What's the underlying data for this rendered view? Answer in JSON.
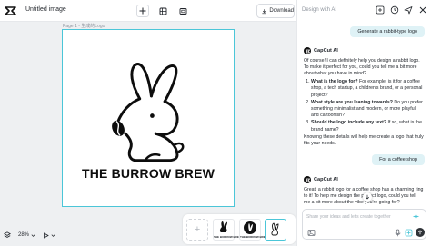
{
  "app": {
    "document_title": "Untitled image",
    "download_label": "Download"
  },
  "canvas": {
    "page_label": "Page 1 - 生成的Logo",
    "brand_text": "THE BURROW BREW",
    "zoom": "28%"
  },
  "thumbnails": [
    {
      "caption": "THE BURROW BREW"
    },
    {
      "caption": "THE BURROW BREW"
    },
    {
      "caption": ""
    }
  ],
  "chat": {
    "header_placeholder": "Design with AI",
    "user_message_1": "Generate a rabbit-type logo",
    "bot_name": "CapCut AI",
    "bot_reply_1": {
      "intro": "Of course! I can definitely help you design a rabbit logo. To make it perfect for you, could you tell me a bit more about what you have in mind?",
      "q1_title": "What is the logo for?",
      "q1_text": "For example, is it for a coffee shop, a tech startup, a children's brand, or a personal project?",
      "q2_title": "What style are you leaning towards?",
      "q2_text": "Do you prefer something minimalist and modern, or more playful and cartoonish?",
      "q3_title": "Should the logo include any text?",
      "q3_text": "If so, what is the brand name?",
      "outro": "Knowing these details will help me create a logo that truly fits your needs."
    },
    "user_message_2": "For a coffee shop",
    "bot_reply_2": "Great, a rabbit logo for a coffee shop has a charming ring to it! To help me design the perfect logo, could you tell me a bit more about the vibe you're going for?",
    "input_placeholder": "Share your ideas and let's create together"
  },
  "colors": {
    "accent": "#4bc6d8",
    "user_bubble": "#dff2f6",
    "send_button": "#2f3338"
  },
  "icons": [
    "capcut-logo-icon",
    "plus-icon",
    "grid-icon",
    "screenshot-icon",
    "download-icon",
    "history-icon",
    "settings-icon",
    "send-icon",
    "close-icon",
    "layers-icon",
    "zoom-icon",
    "play-icon",
    "scroll-down-icon",
    "image-upload-icon",
    "mic-icon",
    "sparkle-icon",
    "arrow-up-icon"
  ]
}
